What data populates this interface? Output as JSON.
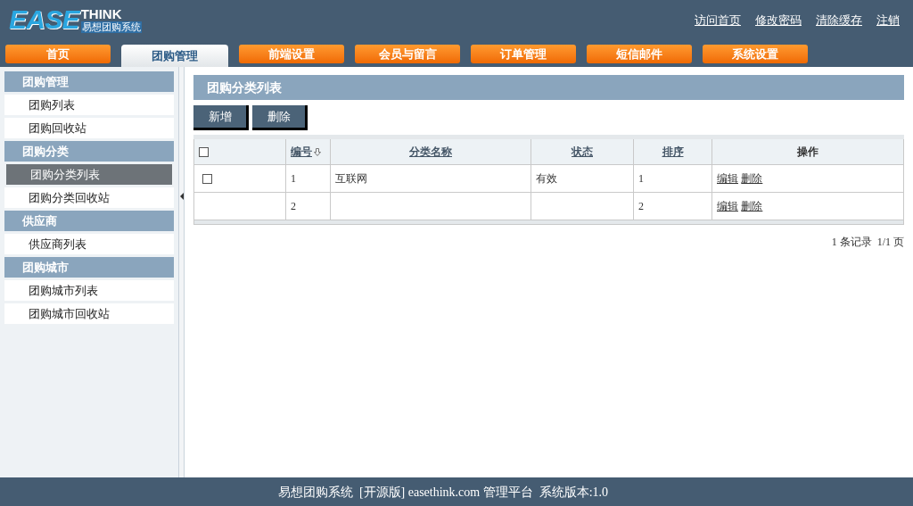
{
  "logo": {
    "main": "EASE",
    "accent": "THINK",
    "subtitle": "易想团购系统"
  },
  "top_links": [
    "访问首页",
    "修改密码",
    "清除缓存",
    "注销"
  ],
  "nav_tabs": [
    {
      "label": "首页",
      "selected": false
    },
    {
      "label": "团购管理",
      "selected": true
    },
    {
      "label": "前端设置",
      "selected": false
    },
    {
      "label": "会员与留言",
      "selected": false
    },
    {
      "label": "订单管理",
      "selected": false
    },
    {
      "label": "短信邮件",
      "selected": false
    },
    {
      "label": "系统设置",
      "selected": false
    }
  ],
  "sidebar": [
    {
      "title": "团购管理",
      "items": [
        {
          "label": "团购列表",
          "selected": false
        },
        {
          "label": "团购回收站",
          "selected": false
        }
      ]
    },
    {
      "title": "团购分类",
      "items": [
        {
          "label": "团购分类列表",
          "selected": true
        },
        {
          "label": "团购分类回收站",
          "selected": false
        }
      ]
    },
    {
      "title": "供应商",
      "items": [
        {
          "label": "供应商列表",
          "selected": false
        }
      ]
    },
    {
      "title": "团购城市",
      "items": [
        {
          "label": "团购城市列表",
          "selected": false
        },
        {
          "label": "团购城市回收站",
          "selected": false
        }
      ]
    }
  ],
  "panel_title": "团购分类列表",
  "buttons": [
    "新增",
    "删除"
  ],
  "table": {
    "select_all": {
      "checked": false
    },
    "columns": [
      {
        "label": "编号",
        "sortable": true,
        "sort_icon": true
      },
      {
        "label": "分类名称",
        "sortable": true
      },
      {
        "label": "状态",
        "sortable": true
      },
      {
        "label": "排序",
        "sortable": true
      },
      {
        "label": "操作",
        "sortable": false
      }
    ],
    "rows": [
      {
        "checkbox": true,
        "checked": false,
        "id": "1",
        "name": "互联网",
        "status": "有效",
        "order": "1",
        "actions": [
          "编辑",
          "删除"
        ]
      },
      {
        "checkbox": false,
        "id": "2",
        "order": "2",
        "actions": [
          "编辑",
          "删除"
        ]
      }
    ]
  },
  "pagination": "1 条记录  1/1 页",
  "footer": "易想团购系统  [开源版] easethink.com 管理平台  系统版本:1.0"
}
